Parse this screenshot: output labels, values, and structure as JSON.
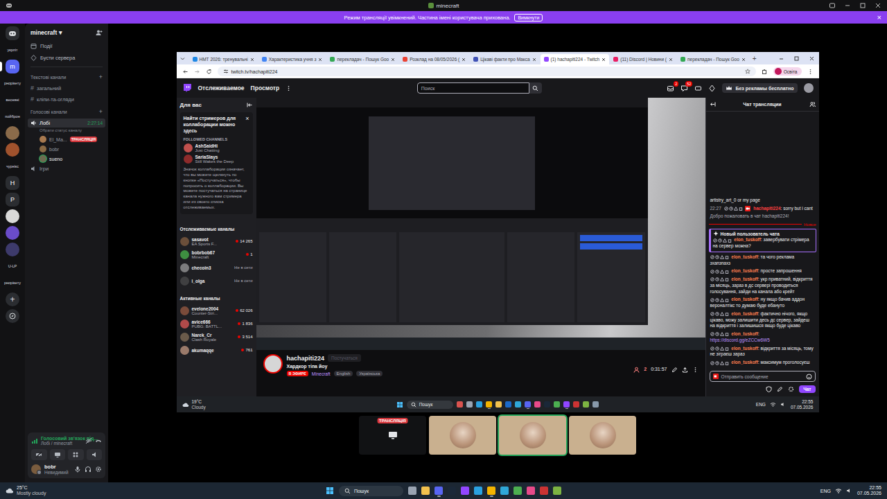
{
  "window": {
    "title": "minecraft"
  },
  "banner": {
    "text": "Режим трансляції увімкнений. Частина імені користувача прихована.",
    "button": "Вимкнути",
    "close": "×"
  },
  "rail": [
    {
      "kind": "home",
      "selected": false
    },
    {
      "kind": "caption",
      "text": "укрліт"
    },
    {
      "kind": "letter",
      "text": "m",
      "color": "#5865f2",
      "selected": true
    },
    {
      "kind": "caption",
      "text": "рнорікету"
    },
    {
      "kind": "caption",
      "text": "весняні"
    },
    {
      "kind": "caption",
      "text": "пойброн"
    },
    {
      "kind": "avatar",
      "color": "#8b6b4a",
      "selected": false
    },
    {
      "kind": "avatar",
      "color": "#a0522d",
      "selected": false
    },
    {
      "kind": "caption",
      "text": "чурнікс"
    },
    {
      "kind": "letter",
      "text": "H",
      "color": "#2b2d31",
      "selected": false
    },
    {
      "kind": "letter",
      "text": "P",
      "color": "#2b2d31",
      "selected": false
    },
    {
      "kind": "avatar",
      "color": "#d8d8d8",
      "selected": false
    },
    {
      "kind": "avatar",
      "color": "#6a4cc9",
      "selected": false
    },
    {
      "kind": "avatar",
      "color": "#3d3a6b",
      "selected": false
    },
    {
      "kind": "caption",
      "text": "U-LP"
    },
    {
      "kind": "caption",
      "text": "рнорікету"
    },
    {
      "kind": "add",
      "text": "+"
    },
    {
      "kind": "explore"
    }
  ],
  "server": {
    "name": "minecraft",
    "chevron": "▾"
  },
  "nav": [
    {
      "kind": "events",
      "label": "Події"
    },
    {
      "kind": "boost",
      "label": "Бусти сервера"
    }
  ],
  "categories": {
    "text": {
      "label": "Текстові канали",
      "add": "+"
    },
    "voice": {
      "label": "Голосові канали",
      "add": "+"
    }
  },
  "text_channels": [
    {
      "hash": "#",
      "name": "загальний",
      "selected": false
    },
    {
      "hash": "#",
      "name": "кліпи-та-огляди",
      "selected": false
    }
  ],
  "voice_channel": {
    "name": "Лобі",
    "timer": "2:27:14",
    "status": "Обрати статус каналу",
    "selected": true,
    "members": [
      {
        "name": "El_Ma...",
        "badge": "ТРАНСЛЯЦІЯ",
        "color": "#a7794f",
        "speaking": false
      },
      {
        "name": "bobr",
        "color": "#8a6a45",
        "speaking": false
      },
      {
        "name": "sueno",
        "color": "#6d6a50",
        "speaking": true
      }
    ]
  },
  "games_channel": {
    "name": "Ігри"
  },
  "voice_panel": {
    "status": "Голосовий зв'язок під...",
    "channel": "Лобі / minecraft"
  },
  "user": {
    "name": "bobr",
    "status": "Невидимий"
  },
  "browser": {
    "tabs": [
      {
        "title": "НМТ 2026: тренувальні",
        "color": "#1e88e5",
        "selected": false
      },
      {
        "title": "Характеристика учня з",
        "color": "#4285f4",
        "selected": false
      },
      {
        "title": "перекладач - Пошук Goo",
        "color": "#34a853",
        "selected": false
      },
      {
        "title": "Розклад на 08/05/2026 (",
        "color": "#ea4335",
        "selected": false
      },
      {
        "title": "Цікаві факти про Макса",
        "color": "#3f51b5",
        "selected": false
      },
      {
        "title": "(1) hachapiti224 - Twitch",
        "color": "#9146ff",
        "selected": true
      },
      {
        "title": "(11) Discord | Новини (",
        "color": "#e91e63",
        "selected": false
      },
      {
        "title": "перекладач - Пошук Goo",
        "color": "#34a853",
        "selected": false
      }
    ],
    "new_tab": "+",
    "url": "twitch.tv/hachapiti224",
    "profile": "Освіта"
  },
  "twitch": {
    "nav": [
      "Отслеживаемое",
      "Просмотр"
    ],
    "search": "Поиск",
    "badges": [
      "2",
      "52"
    ],
    "promo": "Без рекламы бесплатно",
    "sidebar": {
      "title": "Для вас",
      "collab": {
        "title": "Найти стримеров для коллаборации можно здесь",
        "close": "×",
        "section": "FOLLOWED CHANNELS",
        "channels": [
          {
            "name": "AshSaidHi",
            "game": "Just Chatting",
            "color": "#c0504d"
          },
          {
            "name": "SariaSlays",
            "game": "Still Wakes the Deep",
            "color": "#8e2b2b"
          }
        ],
        "text": "Значок коллаборации означает, что вы можете щелкнуть по кнопке «Постучаться», чтобы попросить о коллаборации. Вы можете постучаться на странице канала нужного вам стримера или из своего списка отслеживаемых."
      },
      "followed": {
        "title": "Отслеживаемые каналы",
        "channels": [
          {
            "name": "sasavot",
            "game": "EA Sports F...",
            "viewers": "14 265",
            "live": true,
            "color": "#6b4f3a"
          },
          {
            "name": "bobrbob67",
            "game": "Minecraft",
            "viewers": "1",
            "live": true,
            "color": "#3e8e41"
          },
          {
            "name": "checoin3",
            "viewers": "Не в сети",
            "live": false,
            "color": "#bbbbbb"
          },
          {
            "name": "i_olga",
            "viewers": "Не в сети",
            "live": false,
            "color": "#555555"
          }
        ]
      },
      "active": {
        "title": "Активные каналы",
        "channels": [
          {
            "name": "evelone2004",
            "game": "Counter-Stri...",
            "viewers": "62 026",
            "live": true,
            "color": "#7a4b3a"
          },
          {
            "name": "avice666",
            "game": "PUBG: BATTL...",
            "viewers": "1 836",
            "live": true,
            "color": "#b04a4a"
          },
          {
            "name": "Narek_Cr",
            "game": "Clash Royale",
            "viewers": "3 514",
            "live": true,
            "color": "#6a5a4a"
          },
          {
            "name": "akumaqqe",
            "viewers": "761",
            "live": true,
            "color": "#9a7a6a"
          }
        ]
      }
    },
    "channel": {
      "name": "hachapiti224",
      "knock": "Постучаться",
      "title": "Хардкор тіпа йоу",
      "live": "В ЭФИРЕ",
      "game": "Minecraft",
      "tags": [
        "English",
        "Українська"
      ],
      "viewers": "2",
      "uptime": "0:31:57"
    },
    "chat": {
      "title": "Чат трансляции",
      "separator": ":",
      "input": "Отправить сообщение",
      "send": "Чат",
      "items": [
        {
          "kind": "text",
          "text": "artistry_art_0 or my page"
        },
        {
          "kind": "message",
          "time": "22:27",
          "broadcaster": true,
          "user": "hachapiti224",
          "text": "sorry but i cant",
          "color": "#ff4040",
          "link": false
        },
        {
          "kind": "system",
          "text": "Добро пожаловать в чат hachapiti224!"
        },
        {
          "kind": "divider",
          "text": "Новое"
        },
        {
          "kind": "highlight",
          "label": "Новый пользователь чата",
          "user": "elon_tuskoff",
          "text": "завербувати стрімера на сервер можна?",
          "color": "#ff7f50"
        },
        {
          "kind": "message",
          "broadcaster": false,
          "user": "elon_tuskoff",
          "text": "та чого реклама зхапзпахз",
          "color": "#ff7f50",
          "link": false
        },
        {
          "kind": "message",
          "broadcaster": false,
          "user": "elon_tuskoff",
          "text": "просте запрошення",
          "color": "#ff7f50",
          "link": false
        },
        {
          "kind": "message",
          "broadcaster": false,
          "user": "elon_tuskoff",
          "text": "укр приватний, відкриття за місяць, зараз в дс сервері проводиться голосування, зайди на канала або крейт",
          "color": "#ff7f50",
          "link": false
        },
        {
          "kind": "message",
          "broadcaster": false,
          "user": "elon_tuskoff",
          "text": "ну якщо бачив аддон вероналтікс то думаю буде ебануто",
          "color": "#ff7f50",
          "link": false
        },
        {
          "kind": "message",
          "broadcaster": false,
          "user": "elon_tuskoff",
          "text": "фактично нічого, якщо цікаво, можу залишити десь дс сервер, зайдеш на відкриття і залишишся якщо буде цікаво",
          "color": "#ff7f50",
          "link": false
        },
        {
          "kind": "message",
          "broadcaster": false,
          "user": "elon_tuskoff",
          "text": "https://discord.gg/eZCCw6W5",
          "color": "#ff7f50",
          "link": true
        },
        {
          "kind": "message",
          "broadcaster": false,
          "user": "elon_tuskoff",
          "text": "відкриття за місяць, тому не зіграєш зараз",
          "color": "#ff7f50",
          "link": false
        },
        {
          "kind": "message",
          "broadcaster": false,
          "user": "elon_tuskoff",
          "text": "максимум проголосуєш",
          "color": "#ff7f50",
          "link": false
        }
      ]
    }
  },
  "inner_taskbar": {
    "temp": "19°C",
    "weather": "Cloudy",
    "search": "Пошук",
    "lang": "ENG",
    "time": "22:55",
    "date": "07.05.2026",
    "apps": [
      {
        "color": "#d9534f",
        "selected": false
      },
      {
        "color": "#9aa4b2",
        "selected": false
      },
      {
        "color": "#2aa1e0",
        "selected": false
      },
      {
        "color": "#f4b400",
        "selected": true
      },
      {
        "color": "#f2c14e",
        "selected": false
      },
      {
        "color": "#1b6ac9",
        "selected": false
      },
      {
        "color": "#2fa7d8",
        "selected": false
      },
      {
        "color": "#5865f2",
        "selected": true
      },
      {
        "color": "#e84a8a",
        "selected": false
      },
      {
        "color": "#1b2838",
        "selected": false
      },
      {
        "color": "#4caf50",
        "selected": false
      },
      {
        "color": "#9146ff",
        "selected": true
      },
      {
        "color": "#cc3333",
        "selected": false
      },
      {
        "color": "#7cb342",
        "selected": false
      },
      {
        "color": "#8899aa",
        "selected": false
      }
    ]
  },
  "tiles": [
    {
      "kind": "stream",
      "badge": "ТРАНСЛЯЦІЯ",
      "speaking": false,
      "color": "#111214"
    },
    {
      "kind": "avatar",
      "speaking": false,
      "color": "#c9b08f"
    },
    {
      "kind": "avatar",
      "speaking": true,
      "color": "#c9b08f"
    },
    {
      "kind": "avatar",
      "speaking": false,
      "color": "#c9b08f"
    }
  ],
  "taskbar": {
    "temp": "25°C",
    "weather": "Mostly cloudy",
    "search": "Пошук",
    "lang": "ENG",
    "time": "22:55",
    "date": "07.05.2026",
    "apps": [
      {
        "color": "#9aa4b2",
        "selected": false
      },
      {
        "color": "#f2c14e",
        "selected": false
      },
      {
        "color": "#5865f2",
        "selected": true
      },
      {
        "color": "#1b2838",
        "selected": false
      },
      {
        "color": "#9146ff",
        "selected": false
      },
      {
        "color": "#2aa1e0",
        "selected": false
      },
      {
        "color": "#f4b400",
        "selected": true
      },
      {
        "color": "#2fa7d8",
        "selected": false
      },
      {
        "color": "#4caf50",
        "selected": false
      },
      {
        "color": "#e84a8a",
        "selected": false
      },
      {
        "color": "#cc3333",
        "selected": false
      },
      {
        "color": "#7cb342",
        "selected": false
      }
    ]
  }
}
